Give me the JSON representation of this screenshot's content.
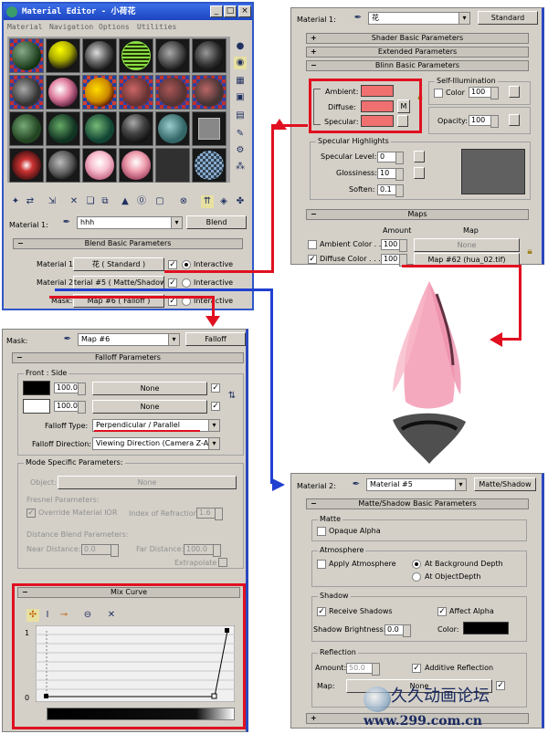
{
  "material_editor": {
    "title": "Material Editor - 小荷花",
    "menu": [
      "Material",
      "Navigation",
      "Options",
      "Utilities"
    ],
    "material_label": "Material 1:",
    "material_name": "hhh",
    "type_button": "Blend",
    "rollout": "Blend Basic Parameters",
    "mat1_label": "Material 1:",
    "mat1_value": "花 ( Standard )",
    "mat2_label": "Material 2:",
    "mat2_value": "terial #5 ( Matte/Shadow )",
    "mask_label": "Mask:",
    "mask_value": "Map #6 ( Falloff )",
    "interactive": "Interactive",
    "window_buttons": [
      "_",
      "□",
      "×"
    ]
  },
  "standard_panel": {
    "material_label": "Material 1:",
    "material_name": "花",
    "type_button": "Standard",
    "rollouts": [
      "Shader Basic Parameters",
      "Extended Parameters",
      "Blinn Basic Parameters"
    ],
    "self_illum": "Self-Illumination",
    "color_label": "Color",
    "color_value": "100",
    "ambient": "Ambient:",
    "diffuse": "Diffuse:",
    "specular": "Specular:",
    "m_button": "M",
    "opacity_label": "Opacity:",
    "opacity_value": "100",
    "spec_group": "Specular Highlights",
    "spec_level": "Specular Level:",
    "spec_level_value": "0",
    "glossiness": "Glossiness:",
    "glossiness_value": "10",
    "soften": "Soften:",
    "soften_value": "0.1",
    "maps_rollout": "Maps",
    "amount_header": "Amount",
    "map_header": "Map",
    "ambient_color": "Ambient Color . .",
    "ambient_amount": "100",
    "ambient_map": "None",
    "diffuse_color": "Diffuse Color . . .",
    "diffuse_amount": "100",
    "diffuse_map": "Map #62 (hua_02.tif)",
    "diffuse_swatch_color": "#f07070"
  },
  "falloff_panel": {
    "mask_label": "Mask:",
    "map_name": "Map #6",
    "type_button": "Falloff",
    "rollout": "Falloff Parameters",
    "front_side": "Front : Side",
    "value1": "100.0",
    "value2": "100.0",
    "none1": "None",
    "none2": "None",
    "falloff_type_label": "Falloff Type:",
    "falloff_type": "Perpendicular / Parallel",
    "falloff_direction_label": "Falloff Direction:",
    "falloff_direction": "Viewing Direction (Camera Z-Axis)",
    "mode_specific": "Mode Specific Parameters:",
    "object_label": "Object:",
    "object_value": "None",
    "fresnel": "Fresnel Parameters:",
    "override_ior": "Override Material IOR",
    "ior_label": "Index of Refraction",
    "ior_value": "1.6",
    "distance_blend": "Distance Blend Parameters:",
    "near_label": "Near Distance:",
    "near_value": "0.0",
    "far_label": "Far Distance:",
    "far_value": "100.0",
    "extrapolate": "Extrapolate",
    "mix_curve": "Mix Curve",
    "curve_top": "1",
    "curve_bottom": "0"
  },
  "matte_panel": {
    "material_label": "Material 2:",
    "material_name": "Material #5",
    "type_button": "Matte/Shadow",
    "rollout": "Matte/Shadow Basic Parameters",
    "matte_group": "Matte",
    "opaque_alpha": "Opaque Alpha",
    "atmosphere_group": "Atmosphere",
    "apply_atmosphere": "Apply Atmosphere",
    "at_background": "At Background Depth",
    "at_object": "At ObjectDepth",
    "shadow_group": "Shadow",
    "receive_shadows": "Receive Shadows",
    "affect_alpha": "Affect Alpha",
    "shadow_brightness": "Shadow Brightness:",
    "shadow_brightness_value": "0.0",
    "color_label": "Color:",
    "reflection_group": "Reflection",
    "amount_label": "Amount:",
    "amount_value": "50.0",
    "additive_reflection": "Additive Reflection",
    "map_label": "Map:",
    "map_value": "None"
  },
  "watermark": {
    "line1": "久久动画论坛",
    "line2": "www.299.com.cn"
  },
  "colors": {
    "accent_red": "#e01020",
    "accent_blue": "#2040d0",
    "swatch_pink": "#f07070"
  }
}
